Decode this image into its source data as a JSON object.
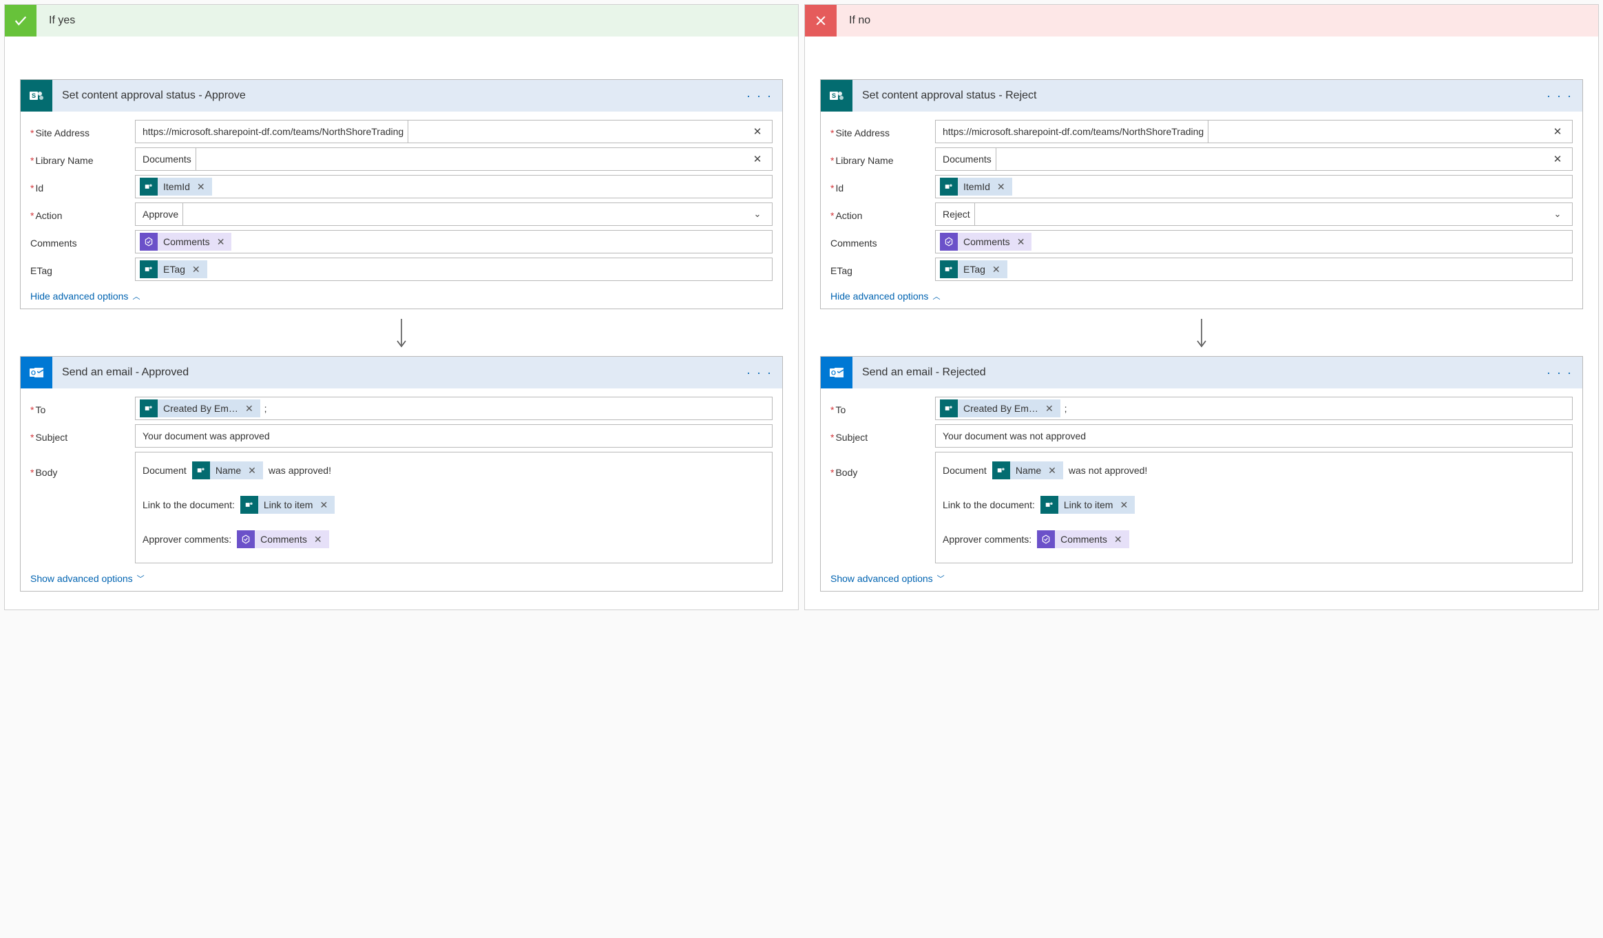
{
  "branches": {
    "yes": {
      "title": "If yes"
    },
    "no": {
      "title": "If no"
    }
  },
  "approve": {
    "card_title": "Set content approval status - Approve",
    "labels": {
      "site": "Site Address",
      "library": "Library Name",
      "id": "Id",
      "action": "Action",
      "comments": "Comments",
      "etag": "ETag"
    },
    "site_value": "https://microsoft.sharepoint-df.com/teams/NorthShoreTrading",
    "library_value": "Documents",
    "id_token": "ItemId",
    "action_value": "Approve",
    "comments_token": "Comments",
    "etag_token": "ETag",
    "hide_adv": "Hide advanced options"
  },
  "reject": {
    "card_title": "Set content approval status - Reject",
    "labels": {
      "site": "Site Address",
      "library": "Library Name",
      "id": "Id",
      "action": "Action",
      "comments": "Comments",
      "etag": "ETag"
    },
    "site_value": "https://microsoft.sharepoint-df.com/teams/NorthShoreTrading",
    "library_value": "Documents",
    "id_token": "ItemId",
    "action_value": "Reject",
    "comments_token": "Comments",
    "etag_token": "ETag",
    "hide_adv": "Hide advanced options"
  },
  "email_approved": {
    "card_title": "Send an email - Approved",
    "labels": {
      "to": "To",
      "subject": "Subject",
      "body": "Body"
    },
    "to_token": "Created By Em…",
    "to_suffix": ";",
    "subject_value": "Your document was approved",
    "body": {
      "l1_pre": "Document",
      "l1_token": "Name",
      "l1_post": "was approved!",
      "l2_pre": "Link to the document:",
      "l2_token": "Link to item",
      "l3_pre": "Approver comments:",
      "l3_token": "Comments"
    },
    "show_adv": "Show advanced options"
  },
  "email_rejected": {
    "card_title": "Send an email - Rejected",
    "labels": {
      "to": "To",
      "subject": "Subject",
      "body": "Body"
    },
    "to_token": "Created By Em…",
    "to_suffix": ";",
    "subject_value": "Your document was not approved",
    "body": {
      "l1_pre": "Document",
      "l1_token": "Name",
      "l1_post": "was not approved!",
      "l2_pre": "Link to the document:",
      "l2_token": "Link to item",
      "l3_pre": "Approver comments:",
      "l3_token": "Comments"
    },
    "show_adv": "Show advanced options"
  }
}
